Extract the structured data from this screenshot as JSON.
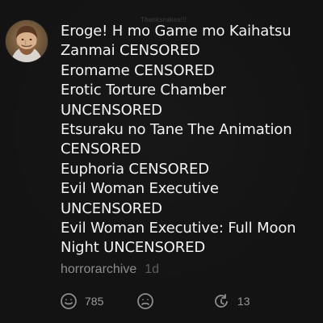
{
  "watermark": {
    "text": "Thanksnakes!!!"
  },
  "comment": {
    "lines": [
      "Eroge! H mo Game mo Kaihatsu",
      "Zanmai CENSORED",
      "Eromame CENSORED",
      "Erotic Torture Chamber",
      "UNCENSORED",
      "Etsuraku no Tane The Animation",
      "CENSORED",
      "Euphoria CENSORED",
      "Evil Woman Executive",
      "UNCENSORED",
      "Evil Woman Executive: Full Moon",
      "Night UNCENSORED"
    ],
    "username": "horrorarchive",
    "time": "1d"
  },
  "actions": {
    "like_count": "785",
    "reply_count": "13"
  },
  "icons": {
    "avatar": "user-avatar",
    "like": "smile-icon",
    "dislike": "sad-icon",
    "reply": "reply-icon"
  }
}
